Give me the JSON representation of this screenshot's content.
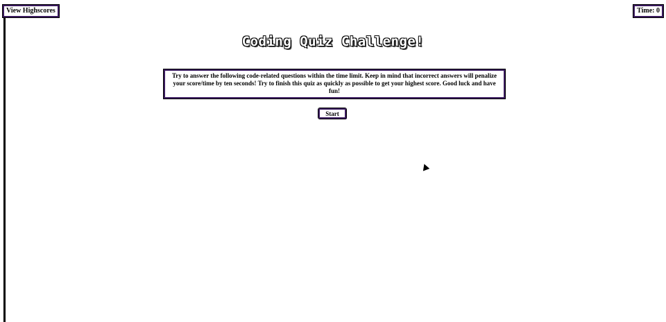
{
  "header": {
    "highscores_label": "View Highscores",
    "timer_label": "Time: 0"
  },
  "main": {
    "title": "Coding Quiz Challenge!",
    "instructions": "Try to answer the following code-related questions within the time limit. Keep in mind that incorrect answers will penalize your score/time by ten seconds! Try to finish this quiz as quickly as possible to get your highest score. Good luck and have fun!",
    "start_label": "Start"
  },
  "colors": {
    "accent": "#3a1a5e",
    "text": "#000000",
    "background": "#ffffff"
  }
}
